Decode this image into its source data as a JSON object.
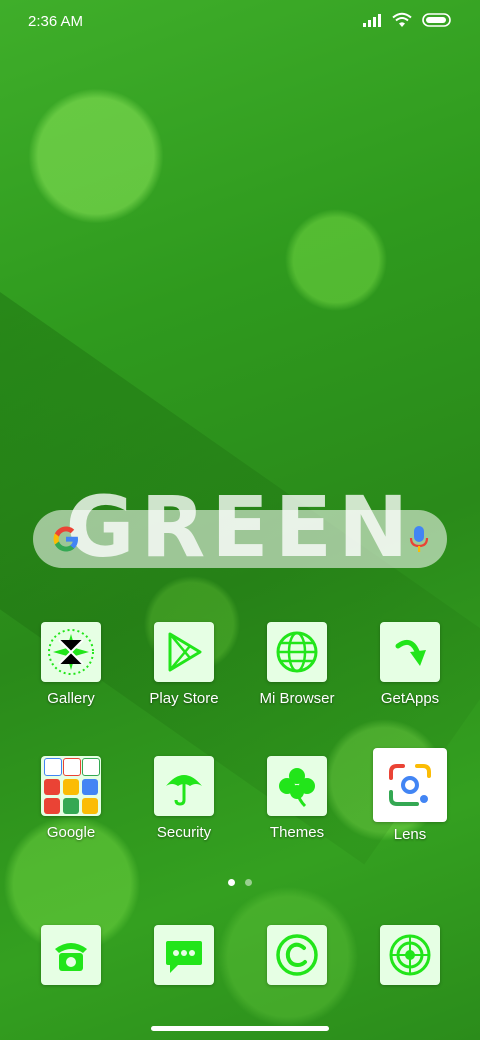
{
  "status_bar": {
    "time": "2:36 AM"
  },
  "wallpaper": {
    "title": "GREEN"
  },
  "search": {
    "provider": "G"
  },
  "apps": [
    {
      "label": "Gallery",
      "icon": "gallery-icon"
    },
    {
      "label": "Play Store",
      "icon": "play-store-icon"
    },
    {
      "label": "Mi Browser",
      "icon": "globe-icon"
    },
    {
      "label": "GetApps",
      "icon": "getapps-arrow-icon"
    },
    {
      "label": "Google",
      "icon": "google-folder-icon"
    },
    {
      "label": "Security",
      "icon": "umbrella-icon"
    },
    {
      "label": "Themes",
      "icon": "clover-icon"
    },
    {
      "label": "Lens",
      "icon": "google-lens-icon"
    }
  ],
  "dock": [
    {
      "icon": "phone-icon"
    },
    {
      "icon": "messages-icon"
    },
    {
      "icon": "copyright-icon"
    },
    {
      "icon": "target-icon"
    }
  ],
  "pages": {
    "count": 2,
    "active": 1
  },
  "colors": {
    "accent": "#22e51a",
    "icon_bg": "#e6ffe4"
  }
}
